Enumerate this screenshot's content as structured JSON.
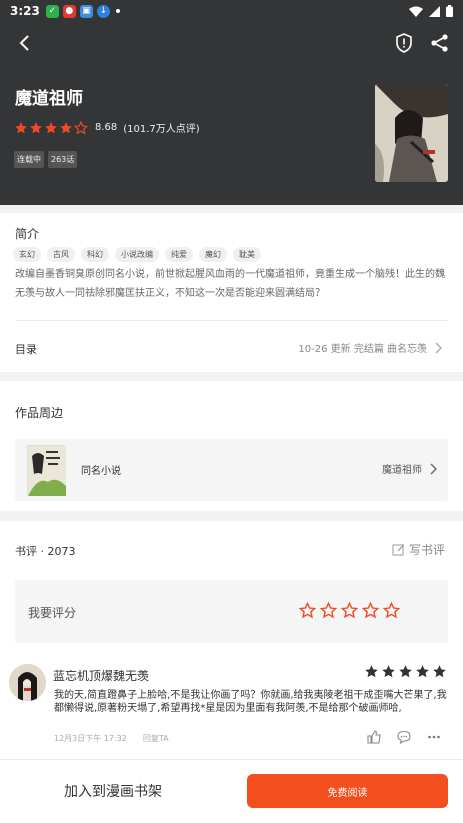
{
  "status_bar": {
    "time": "3:23",
    "notification_icons": [
      "app-icon-green",
      "app-icon-red",
      "app-icon-blue",
      "app-icon-blue-round"
    ],
    "right_icons": [
      "wifi-icon",
      "signal-icon",
      "battery-icon"
    ]
  },
  "header": {
    "title": "魔道祖师",
    "score": "8.68",
    "rating_count": "(101.7万人点评)",
    "status_tags": [
      "连载中",
      "263话"
    ],
    "icons": [
      "back-arrow-icon",
      "shield-alert-icon",
      "share-icon"
    ],
    "stars_full": 4,
    "stars_half": 1
  },
  "intro": {
    "section_title": "简介",
    "genre_tags": [
      "玄幻",
      "古风",
      "科幻",
      "小说改编",
      "纯爱",
      "魔幻",
      "耽美"
    ],
    "description": "改编自墨香铜臭原创同名小说，前世掀起腥风血雨的一代魔道祖师，竟重生成一个脑残！此生的魏无羡与故人一同祛除邪魔匡扶正义，不知这一次是否能迎来圆满结局？",
    "toc_label": "目录",
    "toc_update": "10-26  更新  完结篇 曲名忘羡"
  },
  "around": {
    "section_title": "作品周边",
    "novel_label": "同名小说",
    "novel_title": "魔道祖师"
  },
  "reviews": {
    "header": "书评 · 2073",
    "write_label": "写书评",
    "my_rating_label": "我要评分",
    "my_rating_stars": 5,
    "item": {
      "username": "蓝忘机顶爆魏无羡",
      "stars": 5,
      "text": "我的天,简直蹬鼻子上脸哈,不是我让你画了吗？你就画,给我夷陵老祖干成歪嘴大芒果了,我都懒得说,原著粉天塌了,希望再找*星是因为里面有我阿羡,不是给那个破画师哈,",
      "time": "12月3日下午 17:32",
      "reply": "回复TA"
    }
  },
  "bottom": {
    "shelf_label": "加入到漫画书架",
    "read_label": "免费阅读"
  },
  "colors": {
    "accent": "#f24e1e",
    "hero_bg": "#333537",
    "star_red": "#f04a22"
  }
}
